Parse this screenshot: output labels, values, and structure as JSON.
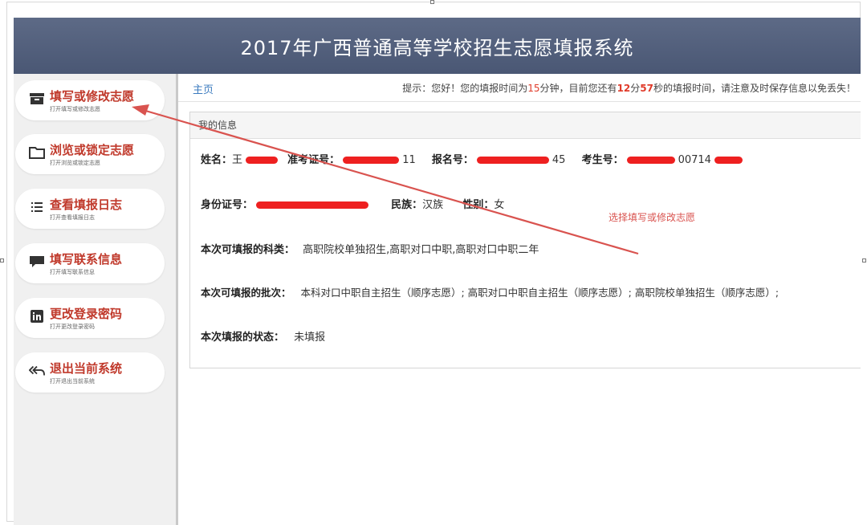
{
  "app": {
    "title": "2017年广西普通高等学校招生志愿填报系统"
  },
  "sidebar": {
    "items": [
      {
        "icon": "inbox-icon",
        "title": "填写或修改志愿",
        "subtitle": "打开填写或修改志愿"
      },
      {
        "icon": "folder-icon",
        "title": "浏览或锁定志愿",
        "subtitle": "打开浏览或锁定志愿"
      },
      {
        "icon": "list-icon",
        "title": "查看填报日志",
        "subtitle": "打开查看填报日志"
      },
      {
        "icon": "chat-icon",
        "title": "填写联系信息",
        "subtitle": "打开填写联系信息"
      },
      {
        "icon": "linkedin-icon",
        "title": "更改登录密码",
        "subtitle": "打开更改登录密码"
      },
      {
        "icon": "reply-all-icon",
        "title": "退出当前系统",
        "subtitle": "打开退出当前系统"
      }
    ]
  },
  "breadcrumb": {
    "home": "主页"
  },
  "notice": {
    "prefix": "提示：您好！您的填报时间为",
    "total_minutes": "15",
    "mid1": "分钟，目前您还有",
    "remain_minutes": "12",
    "mid2": "分",
    "remain_seconds": "57",
    "suffix": "秒的填报时间，请注意及时保存信息以免丢失！"
  },
  "info_panel": {
    "heading": "我的信息",
    "name_label": "姓名：",
    "name_value": "王",
    "exam_id_label": "准考证号：",
    "exam_id_tail": "11",
    "reg_no_label": "报名号：",
    "reg_no_tail": "45",
    "candidate_no_label": "考生号：",
    "candidate_no_tail": "00714",
    "id_card_label": "身份证号：",
    "ethnicity_label": "民族：",
    "ethnicity_value": "汉族",
    "gender_label": "性别：",
    "gender_value": "女",
    "subjects_label": "本次可填报的科类：",
    "subjects_value": "高职院校单独招生,高职对口中职,高职对口中职二年",
    "batches_label": "本次可填报的批次：",
    "batches_value": "本科对口中职自主招生（顺序志愿）; 高职对口中职自主招生（顺序志愿）; 高职院校单独招生（顺序志愿）;",
    "status_label": "本次填报的状态：",
    "status_value": "未填报"
  },
  "annotation": {
    "text": "选择填写或修改志愿",
    "color": "#d9534f"
  },
  "colors": {
    "header": "#4a5774",
    "accent_red": "#c0392b",
    "link_blue": "#3b7bbf",
    "redaction": "#ee2020"
  }
}
